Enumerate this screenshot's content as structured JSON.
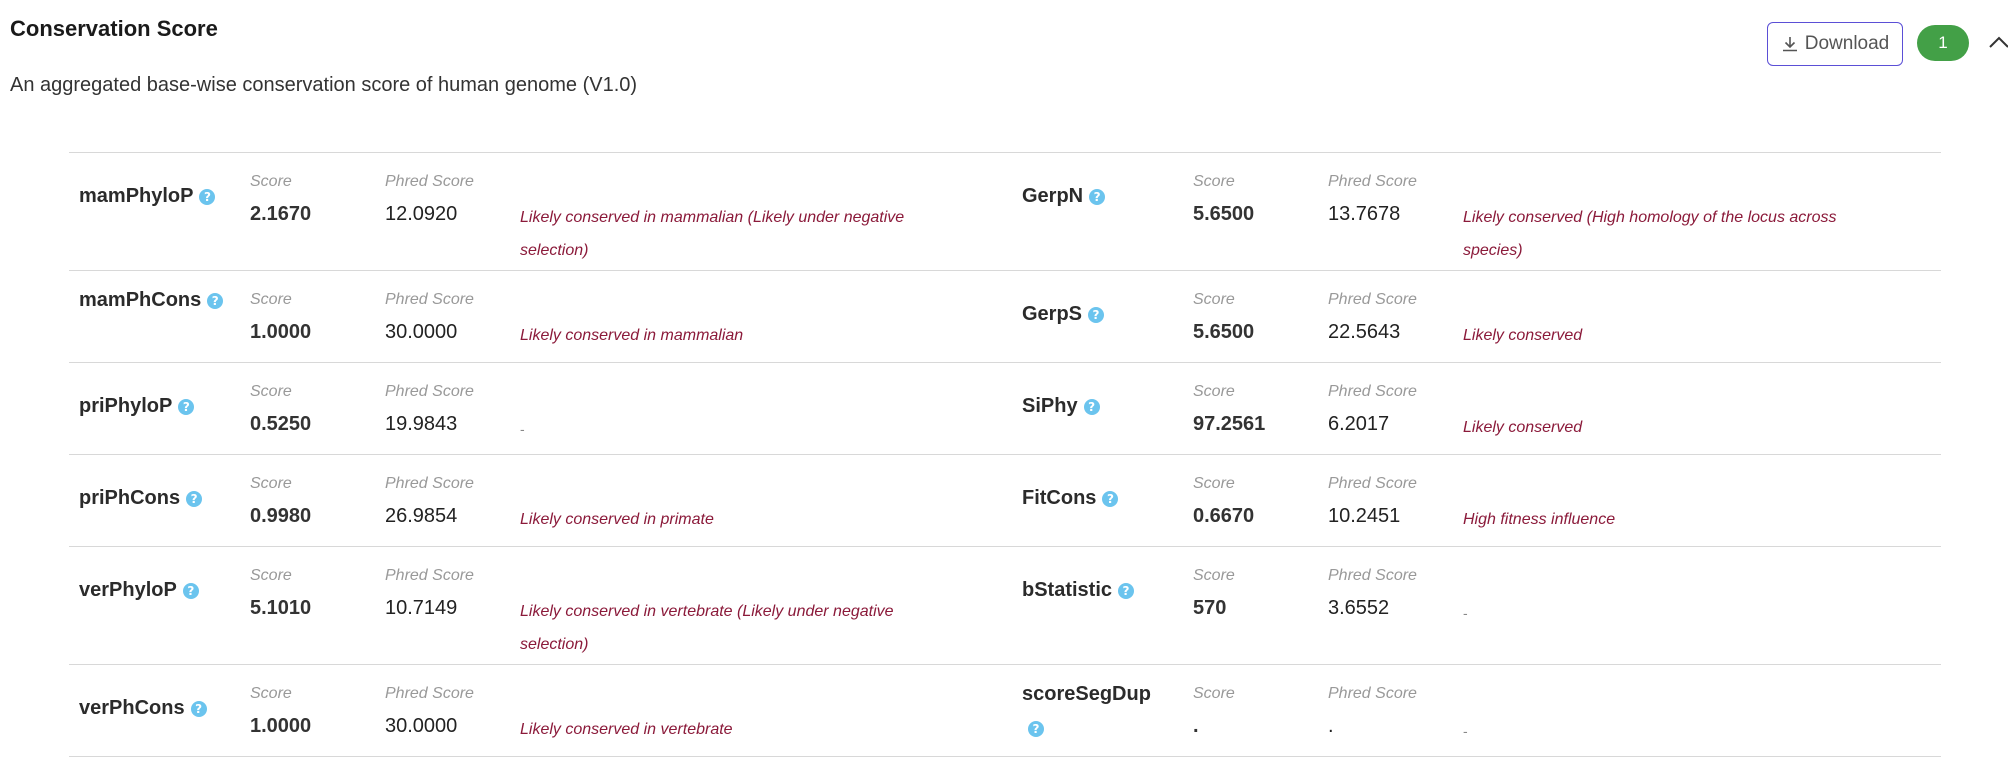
{
  "header": {
    "title": "Conservation Score",
    "subtitle": "An aggregated base-wise conservation score of human genome (V1.0)",
    "download_label": "Download",
    "count": "1"
  },
  "labels": {
    "score": "Score",
    "phred": "Phred Score"
  },
  "help_glyph": "?",
  "rows": [
    {
      "left": {
        "name": "mamPhyloP",
        "score": "2.1670",
        "phred": "12.0920",
        "note": "Likely conserved in mammalian (Likely under negative selection)"
      },
      "right": {
        "name": "GerpN",
        "score": "5.6500",
        "phred": "13.7678",
        "note": "Likely conserved (High homology of the locus across species)"
      }
    },
    {
      "left": {
        "name": "mamPhCons",
        "score": "1.0000",
        "phred": "30.0000",
        "note": "Likely conserved in mammalian"
      },
      "right": {
        "name": "GerpS",
        "score": "5.6500",
        "phred": "22.5643",
        "note": "Likely conserved"
      }
    },
    {
      "left": {
        "name": "priPhyloP",
        "score": "0.5250",
        "phred": "19.9843",
        "note": "-"
      },
      "right": {
        "name": "SiPhy",
        "score": "97.2561",
        "phred": "6.2017",
        "note": "Likely conserved"
      }
    },
    {
      "left": {
        "name": "priPhCons",
        "score": "0.9980",
        "phred": "26.9854",
        "note": "Likely conserved in primate"
      },
      "right": {
        "name": "FitCons",
        "score": "0.6670",
        "phred": "10.2451",
        "note": "High fitness influence"
      }
    },
    {
      "left": {
        "name": "verPhyloP",
        "score": "5.1010",
        "phred": "10.7149",
        "note": "Likely conserved in vertebrate (Likely under negative selection)"
      },
      "right": {
        "name": "bStatistic",
        "score": "570",
        "phred": "3.6552",
        "note": "-"
      }
    },
    {
      "left": {
        "name": "verPhCons",
        "score": "1.0000",
        "phred": "30.0000",
        "note": "Likely conserved in vertebrate"
      },
      "right": {
        "name": "scoreSegDup",
        "score": ".",
        "phred": ".",
        "note": "-"
      }
    }
  ]
}
